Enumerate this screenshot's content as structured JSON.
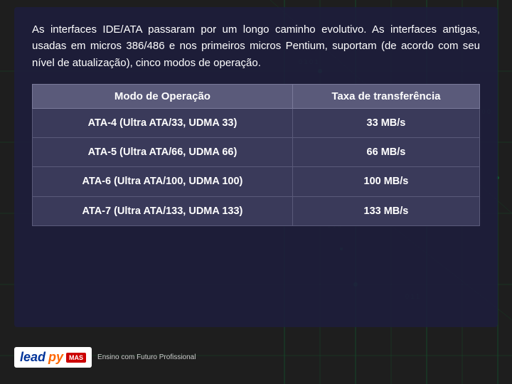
{
  "background": {
    "color": "#1e1e1e"
  },
  "intro": {
    "text": "As interfaces IDE/ATA passaram por um longo caminho evolutivo. As interfaces antigas, usadas em micros 386/486 e nos primeiros micros Pentium, suportam (de acordo com seu nível de atualização), cinco modos de operação."
  },
  "table": {
    "header": {
      "col1": "Modo de Operação",
      "col2": "Taxa de transferência"
    },
    "rows": [
      {
        "mode": "ATA-4 (Ultra ATA/33, UDMA 33)",
        "rate": "33 MB/s"
      },
      {
        "mode": "ATA-5 (Ultra ATA/66, UDMA 66)",
        "rate": "66 MB/s"
      },
      {
        "mode": "ATA-6 (Ultra ATA/100, UDMA 100)",
        "rate": "100 MB/s"
      },
      {
        "mode": "ATA-7 (Ultra ATA/133, UDMA 133)",
        "rate": "133 MB/s"
      }
    ]
  },
  "logo": {
    "main": "lead",
    "sub": "py",
    "badge": "MAS",
    "tagline": "Ensino com Futuro Profissional"
  }
}
